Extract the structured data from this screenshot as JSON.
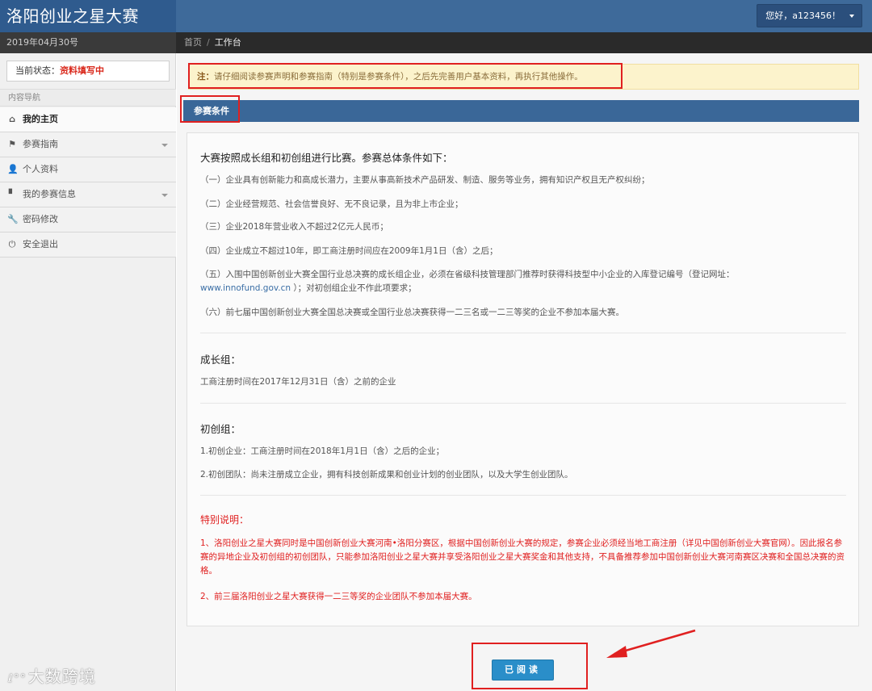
{
  "app": {
    "title": "洛阳创业之星大赛",
    "date": "2019年04月30号"
  },
  "header": {
    "user_greeting": "您好，a123456！"
  },
  "breadcrumb": {
    "home": "首页",
    "separator": "/",
    "current": "工作台"
  },
  "sidebar": {
    "status_label": "当前状态：",
    "status_value": "资料填写中",
    "nav_title": "内容导航",
    "items": [
      {
        "label": "我的主页",
        "icon": "home-icon",
        "glyph": "⌂",
        "active": true,
        "has_submenu": false
      },
      {
        "label": "参赛指南",
        "icon": "flag-icon",
        "glyph": "⚑",
        "active": false,
        "has_submenu": true
      },
      {
        "label": "个人资料",
        "icon": "user-icon",
        "glyph": "👤",
        "active": false,
        "has_submenu": false
      },
      {
        "label": "我的参赛信息",
        "icon": "file-icon",
        "glyph": "▘",
        "active": false,
        "has_submenu": true
      },
      {
        "label": "密码修改",
        "icon": "wrench-icon",
        "glyph": "🔧",
        "active": false,
        "has_submenu": false
      },
      {
        "label": "安全退出",
        "icon": "power-icon",
        "glyph": "⏻",
        "active": false,
        "has_submenu": false
      }
    ]
  },
  "watermark": {
    "text": "大数跨境",
    "logo": "ℓ°°"
  },
  "notice": {
    "label": "注：",
    "text": "请仔细阅读参赛声明和参赛指南（特别是参赛条件），之后先完善用户基本资料，再执行其他操作。"
  },
  "panel": {
    "title": "参赛条件",
    "intro": "大赛按照成长组和初创组进行比赛。参赛总体条件如下：",
    "conditions": [
      "（一）企业具有创新能力和高成长潜力，主要从事高新技术产品研发、制造、服务等业务，拥有知识产权且无产权纠纷；",
      "（二）企业经营规范、社会信誉良好、无不良记录，且为非上市企业；",
      "（三）企业2018年营业收入不超过2亿元人民币；",
      "（四）企业成立不超过10年，即工商注册时间应在2009年1月1日（含）之后；",
      "（五）入围中国创新创业大赛全国行业总决赛的成长组企业，必须在省级科技管理部门推荐时获得科技型中小企业的入库登记编号（登记网址：",
      "（六）前七届中国创新创业大赛全国总决赛或全国行业总决赛获得一二三名或一二三等奖的企业不参加本届大赛。"
    ],
    "condition5_link": "www.innofund.gov.cn",
    "condition5_tail": "）；对初创组企业不作此项要求；",
    "growth": {
      "title": "成长组：",
      "text": "工商注册时间在2017年12月31日（含）之前的企业"
    },
    "startup": {
      "title": "初创组：",
      "items": [
        "1.初创企业：工商注册时间在2018年1月1日（含）之后的企业；",
        "2.初创团队：尚未注册成立企业，拥有科技创新成果和创业计划的创业团队，以及大学生创业团队。"
      ]
    },
    "special": {
      "title": "特别说明：",
      "items": [
        "1、洛阳创业之星大赛同时是中国创新创业大赛河南•洛阳分赛区，根据中国创新创业大赛的规定，参赛企业必须经当地工商注册（详见中国创新创业大赛官网）。因此报名参赛的异地企业及初创组的初创团队，只能参加洛阳创业之星大赛并享受洛阳创业之星大赛奖金和其他支持，不具备推荐参加中国创新创业大赛河南赛区决赛和全国总决赛的资格。",
        "2、前三届洛阳创业之星大赛获得一二三等奖的企业团队不参加本届大赛。"
      ]
    }
  },
  "actions": {
    "read_label": "已阅读"
  },
  "colors": {
    "brand": "#2f5b8e",
    "header": "#3e6a9a",
    "panel_head": "#3a6798",
    "accent_red": "#e02020",
    "button": "#2a8ec9"
  }
}
